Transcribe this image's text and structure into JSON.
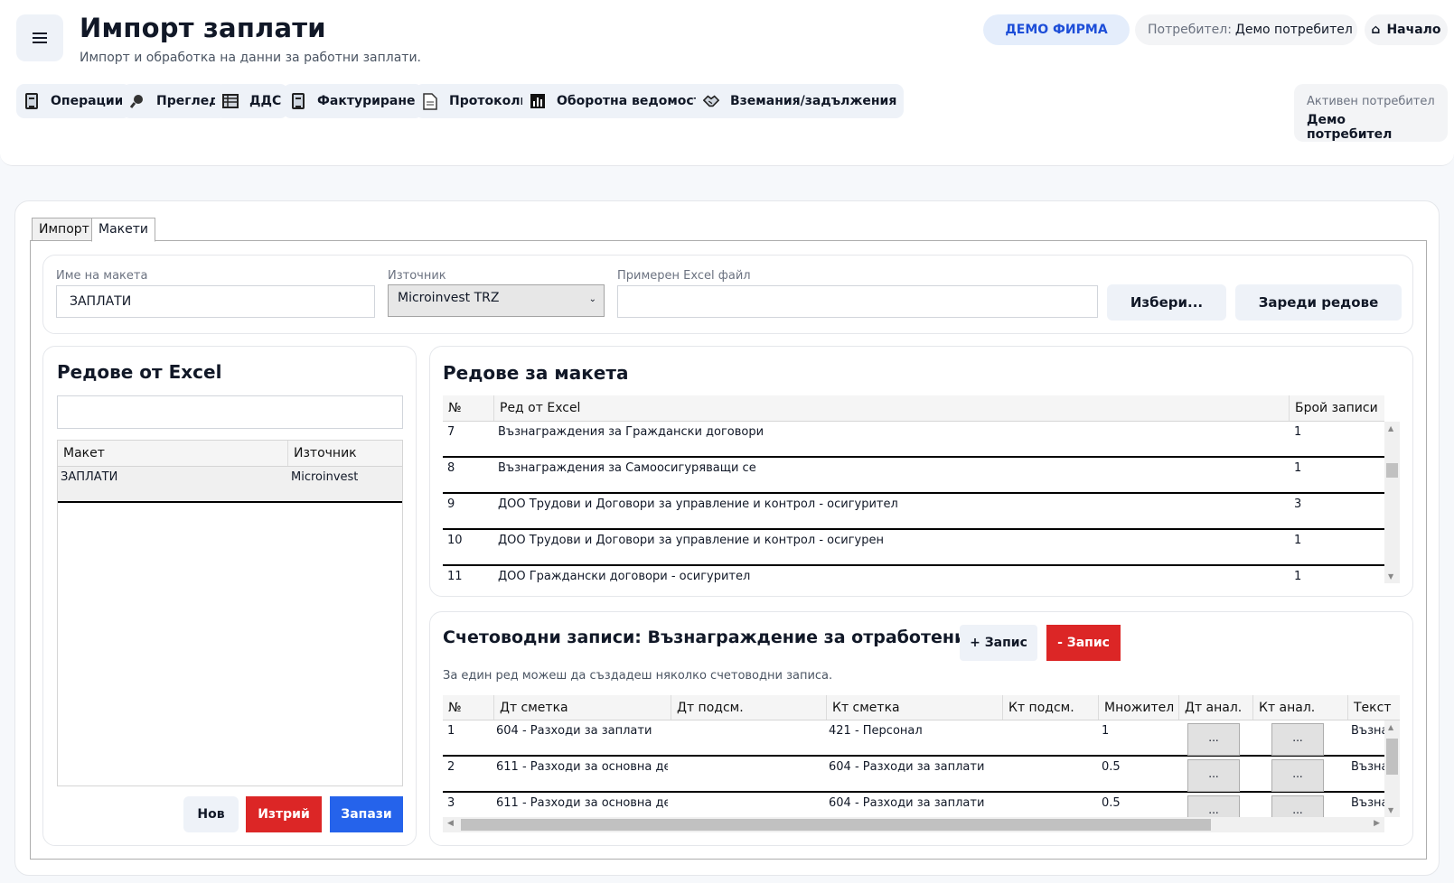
{
  "header": {
    "title": "Импорт заплати",
    "subtitle": "Импорт и обработка на данни за работни заплати.",
    "company": "ДЕМО ФИРМА",
    "user_label": "Потребител:",
    "user_name": "Демо потребител",
    "home_label": "Начало",
    "active_user_label": "Активен потребител",
    "active_user_name": "Демо потребител"
  },
  "nav": [
    {
      "label": "Операции",
      "icon": "ledger-icon"
    },
    {
      "label": "Преглед",
      "icon": "magnifier-icon"
    },
    {
      "label": "ДДС",
      "icon": "register-icon"
    },
    {
      "label": "Фактуриране",
      "icon": "invoice-icon"
    },
    {
      "label": "Протоколи",
      "icon": "document-icon"
    },
    {
      "label": "Оборотна ведомост",
      "icon": "bar-chart-icon"
    },
    {
      "label": "Вземания/задължения",
      "icon": "handshake-icon"
    }
  ],
  "tabs": [
    "Импорт",
    "Макети"
  ],
  "form": {
    "layout_name_label": "Име на макета",
    "layout_name_value": "ЗАПЛАТИ",
    "source_label": "Източник",
    "source_value": "Microinvest TRZ",
    "sample_file_label": "Примерен Excel файл",
    "sample_file_value": "",
    "choose_button": "Избери...",
    "load_rows_button": "Зареди редове"
  },
  "excel_rows_panel": {
    "title": "Редове от Excel",
    "filter_value": "",
    "columns": [
      "Макет",
      "Източник"
    ],
    "rows": [
      {
        "layout": "ЗАПЛАТИ",
        "source": "Microinvest"
      }
    ],
    "new_button": "Нов",
    "delete_button": "Изтрий",
    "save_button": "Запази"
  },
  "layout_rows_panel": {
    "title": "Редове за макета",
    "columns": [
      "№",
      "Ред от Excel",
      "Брой записи"
    ],
    "rows": [
      {
        "no": "7",
        "row": "Възнаграждения за Граждански договори",
        "count": "1"
      },
      {
        "no": "8",
        "row": "Възнаграждения за Самоосигуряващи се",
        "count": "1"
      },
      {
        "no": "9",
        "row": "ДОО Трудови и Договори за управление и контрол - осигурител",
        "count": "3"
      },
      {
        "no": "10",
        "row": "ДОО Трудови и Договори за управление и контрол - осигурен",
        "count": "1"
      },
      {
        "no": "11",
        "row": "ДОО Граждански договори - осигурител",
        "count": "1"
      }
    ]
  },
  "entries_panel": {
    "title": "Счетоводни записи: Възнаграждение за отработени дни",
    "add_button": "+ Запис",
    "remove_button": "- Запис",
    "hint": "За един ред можеш да създадеш няколко счетоводни записа.",
    "columns": [
      "№",
      "Дт сметка",
      "Дт подсм.",
      "Кт сметка",
      "Кт подсм.",
      "Множител",
      "Дт анал.",
      "Кт анал.",
      "Текст"
    ],
    "dots_label": "...",
    "rows": [
      {
        "no": "1",
        "dt": "604 - Разходи за заплати",
        "dt_sub": "",
        "kt": "421 - Персонал",
        "kt_sub": "",
        "mult": "1",
        "text": "Възна"
      },
      {
        "no": "2",
        "dt": "611 - Разходи за основна де",
        "dt_sub": "",
        "kt": "604 - Разходи за заплати",
        "kt_sub": "",
        "mult": "0.5",
        "text": "Възна"
      },
      {
        "no": "3",
        "dt": "611 - Разходи за основна де",
        "dt_sub": "",
        "kt": "604 - Разходи за заплати",
        "kt_sub": "",
        "mult": "0.5",
        "text": "Възна"
      }
    ]
  }
}
